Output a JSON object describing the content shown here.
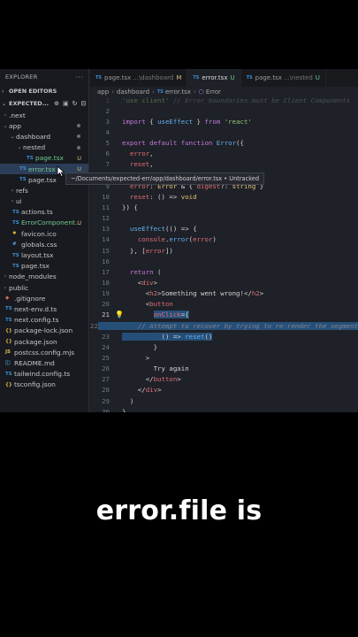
{
  "sidebar": {
    "title": "EXPLORER",
    "open_editors": "OPEN EDITORS",
    "project": "EXPECTED...",
    "tree": [
      {
        "label": ".next",
        "indent": 0,
        "chev": "›",
        "icon": "",
        "status": ""
      },
      {
        "label": "app",
        "indent": 0,
        "chev": "⌄",
        "icon": "",
        "status": "dot"
      },
      {
        "label": "dashboard",
        "indent": 1,
        "chev": "⌄",
        "icon": "",
        "status": "dot"
      },
      {
        "label": "nested",
        "indent": 2,
        "chev": "⌄",
        "icon": "",
        "status": "dot"
      },
      {
        "label": "page.tsx",
        "indent": 3,
        "chev": "",
        "icon": "TS",
        "status": "U"
      },
      {
        "label": "error.tsx",
        "indent": 2,
        "chev": "",
        "icon": "TS",
        "status": "U"
      },
      {
        "label": "page.tsx",
        "indent": 2,
        "chev": "",
        "icon": "TS",
        "status": "dot"
      },
      {
        "label": "refs",
        "indent": 1,
        "chev": "›",
        "icon": "",
        "status": ""
      },
      {
        "label": "ui",
        "indent": 1,
        "chev": "›",
        "icon": "",
        "status": ""
      },
      {
        "label": "actions.ts",
        "indent": 1,
        "chev": "",
        "icon": "TS",
        "status": ""
      },
      {
        "label": "ErrorComponent...",
        "indent": 1,
        "chev": "",
        "icon": "TS",
        "status": "U"
      },
      {
        "label": "favicon.ico",
        "indent": 1,
        "chev": "",
        "icon": "✹",
        "status": ""
      },
      {
        "label": "globals.css",
        "indent": 1,
        "chev": "",
        "icon": "#",
        "status": ""
      },
      {
        "label": "layout.tsx",
        "indent": 1,
        "chev": "",
        "icon": "TS",
        "status": ""
      },
      {
        "label": "page.tsx",
        "indent": 1,
        "chev": "",
        "icon": "TS",
        "status": ""
      },
      {
        "label": "node_modules",
        "indent": 0,
        "chev": "›",
        "icon": "",
        "status": ""
      },
      {
        "label": "public",
        "indent": 0,
        "chev": "›",
        "icon": "",
        "status": ""
      },
      {
        "label": ".gitignore",
        "indent": 0,
        "chev": "",
        "icon": "◆",
        "status": ""
      },
      {
        "label": "next-env.d.ts",
        "indent": 0,
        "chev": "",
        "icon": "TS",
        "status": ""
      },
      {
        "label": "next.config.ts",
        "indent": 0,
        "chev": "",
        "icon": "TS",
        "status": ""
      },
      {
        "label": "package-lock.json",
        "indent": 0,
        "chev": "",
        "icon": "{}",
        "status": ""
      },
      {
        "label": "package.json",
        "indent": 0,
        "chev": "",
        "icon": "{}",
        "status": ""
      },
      {
        "label": "postcss.config.mjs",
        "indent": 0,
        "chev": "",
        "icon": "JS",
        "status": ""
      },
      {
        "label": "README.md",
        "indent": 0,
        "chev": "",
        "icon": "ⓘ",
        "status": ""
      },
      {
        "label": "tailwind.config.ts",
        "indent": 0,
        "chev": "",
        "icon": "TS",
        "status": ""
      },
      {
        "label": "tsconfig.json",
        "indent": 0,
        "chev": "",
        "icon": "{}",
        "status": ""
      }
    ]
  },
  "tabs": [
    {
      "label": "page.tsx",
      "path": "...\\dashboard",
      "status": "M",
      "active": false
    },
    {
      "label": "error.tsx",
      "path": "",
      "status": "U",
      "active": true
    },
    {
      "label": "page.tsx",
      "path": "...\\nested",
      "status": "U",
      "active": false
    }
  ],
  "breadcrumb": [
    "app",
    "dashboard",
    "error.tsx",
    "Error"
  ],
  "tooltip": "~/Documents/expected-err/app/dashboard/error.tsx • Untracked",
  "caption": "error.file is"
}
